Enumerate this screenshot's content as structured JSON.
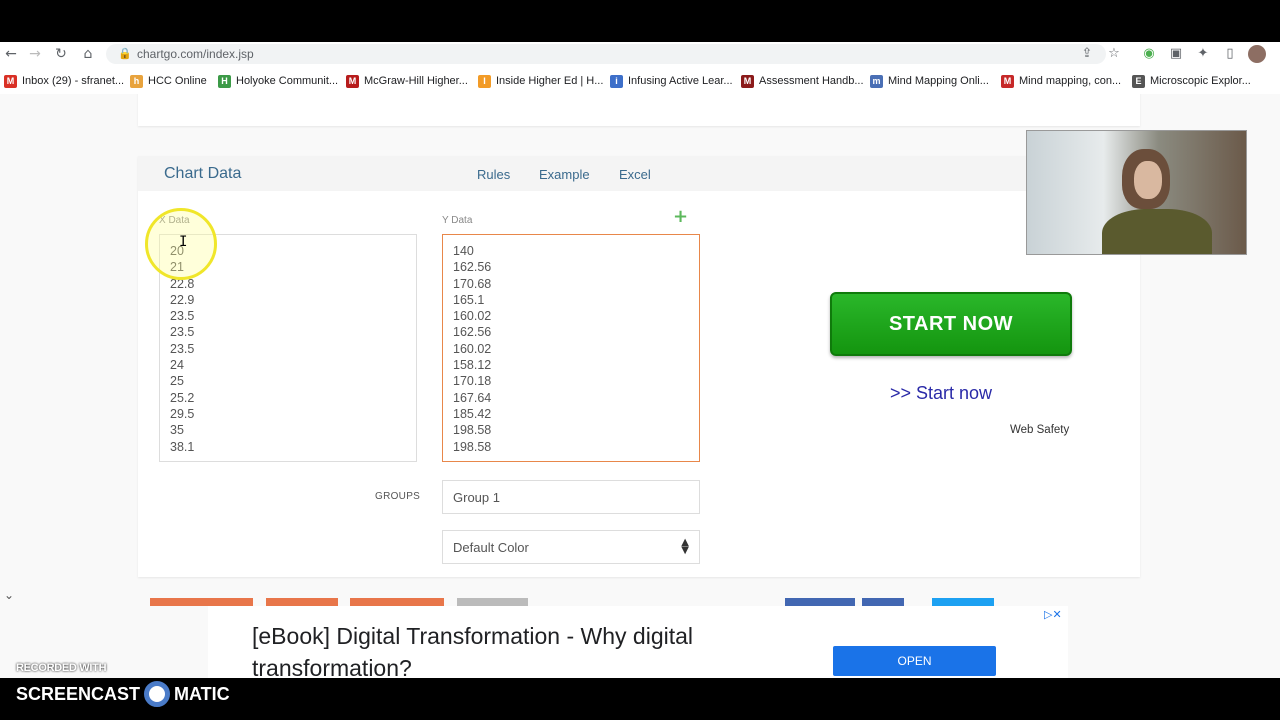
{
  "browser": {
    "url": "chartgo.com/index.jsp",
    "bookmarks": [
      {
        "label": "Inbox (29) - sfranet...",
        "color": "#d93025",
        "glyph": "M"
      },
      {
        "label": "HCC Online",
        "color": "#e8a33d",
        "glyph": "h"
      },
      {
        "label": "Holyoke Communit...",
        "color": "#3c9a47",
        "glyph": "H"
      },
      {
        "label": "McGraw-Hill Higher...",
        "color": "#b71c1c",
        "glyph": "M"
      },
      {
        "label": "Inside Higher Ed | H...",
        "color": "#f29b27",
        "glyph": "I"
      },
      {
        "label": "Infusing Active Lear...",
        "color": "#3d6fc9",
        "glyph": "i"
      },
      {
        "label": "Assessment Handb...",
        "color": "#8b1a1a",
        "glyph": "M"
      },
      {
        "label": "Mind Mapping Onli...",
        "color": "#4a6fb5",
        "glyph": "m"
      },
      {
        "label": "Mind mapping, con...",
        "color": "#c62828",
        "glyph": "M"
      },
      {
        "label": "Microscopic Explor...",
        "color": "#555555",
        "glyph": "E"
      }
    ]
  },
  "chart_data_panel": {
    "title": "Chart Data",
    "tabs": [
      "Rules",
      "Example",
      "Excel"
    ],
    "x_label": "X Data",
    "y_label": "Y Data",
    "x_values": [
      "20",
      "21",
      "22.8",
      "22.9",
      "23.5",
      "23.5",
      "23.5",
      "24",
      "25",
      "25.2",
      "29.5",
      "35",
      "38.1"
    ],
    "y_values": [
      "140",
      "162.56",
      "170.68",
      "165.1",
      "160.02",
      "162.56",
      "160.02",
      "158.12",
      "170.18",
      "167.64",
      "185.42",
      "198.58",
      "198.58"
    ],
    "groups_label": "GROUPS",
    "group_value": "Group 1",
    "color_select": "Default Color"
  },
  "ad_side": {
    "button": "START NOW",
    "link": ">> Start now",
    "note": "Web Safety"
  },
  "ad_bottom": {
    "text": "[eBook] Digital Transformation - Why digital transformation?",
    "open": "OPEN"
  },
  "watermark": {
    "line1": "RECORDED WITH",
    "brand_left": "SCREENCAST",
    "brand_right": "MATIC"
  }
}
